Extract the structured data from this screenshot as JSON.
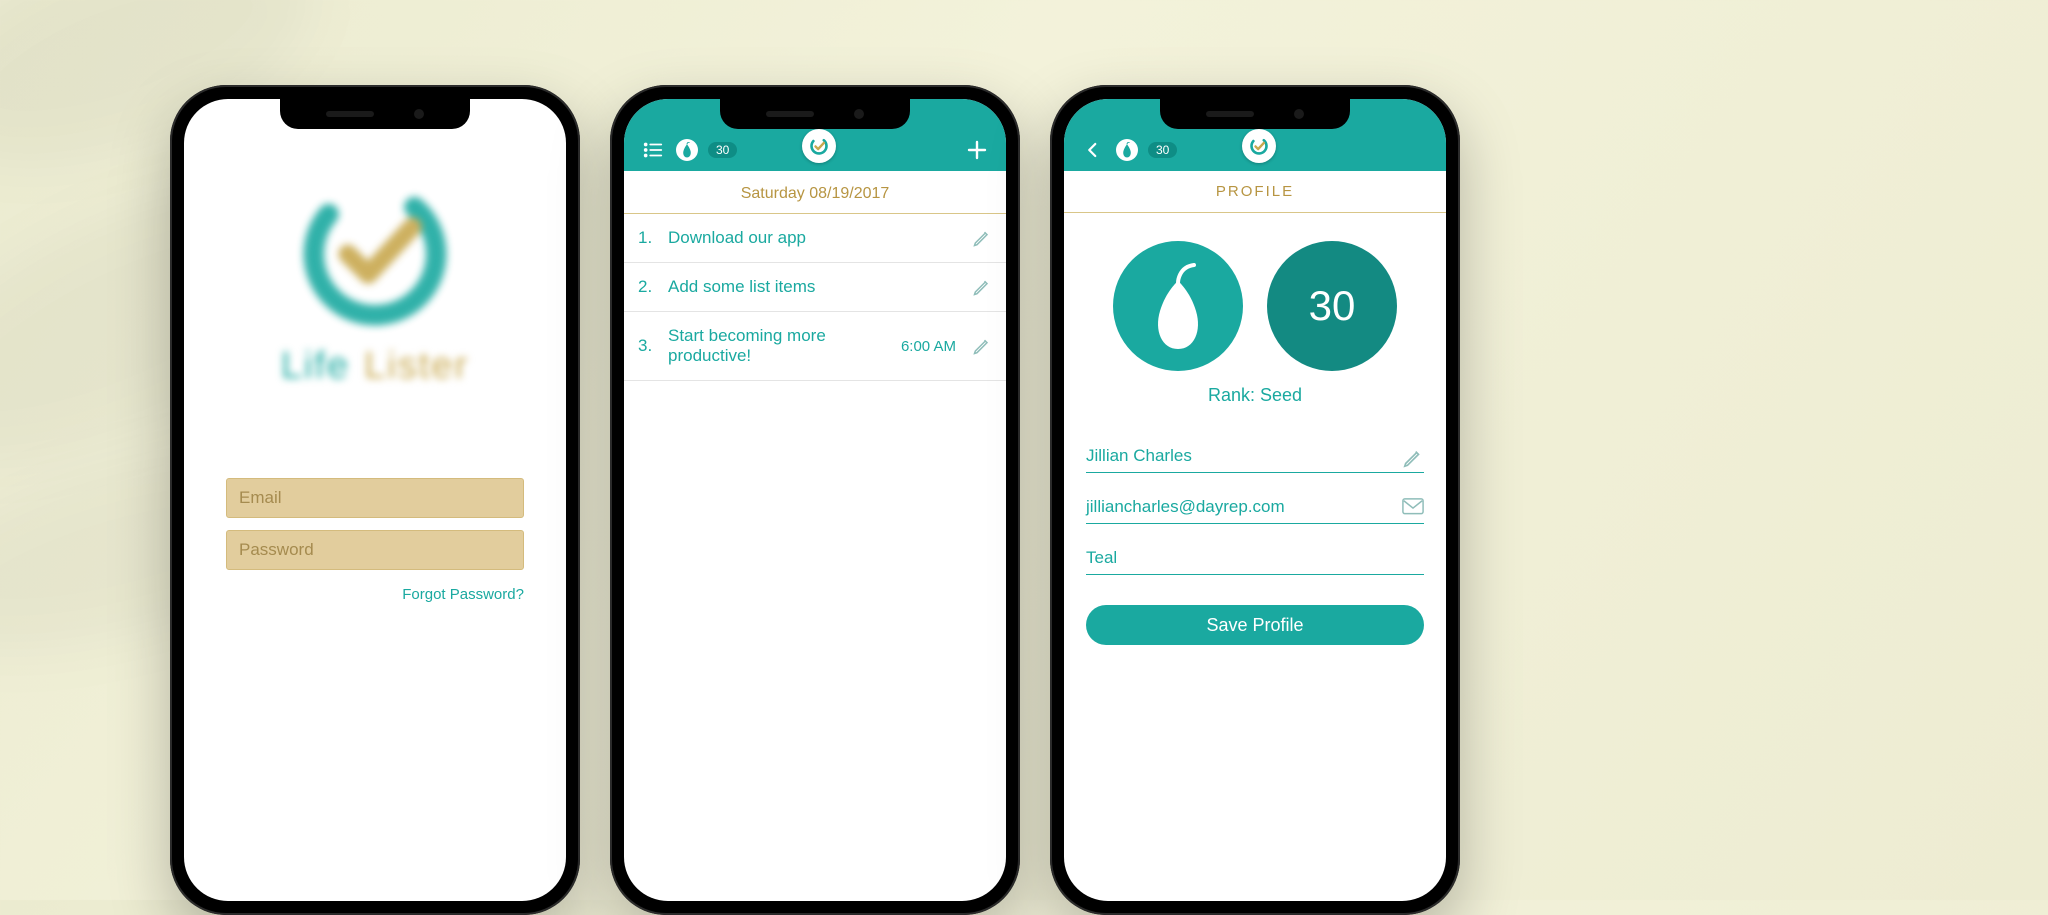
{
  "brand": {
    "word1": "Life",
    "word2": "Lister"
  },
  "colors": {
    "teal": "#1aa9a0",
    "tealDark": "#138a82",
    "gold": "#b79542",
    "fieldBg": "#e2cd9d"
  },
  "login": {
    "email_placeholder": "Email",
    "password_placeholder": "Password",
    "forgot": "Forgot Password?"
  },
  "listScreen": {
    "points": "30",
    "date": "Saturday 08/19/2017",
    "items": [
      {
        "n": "1.",
        "text": "Download our app",
        "time": ""
      },
      {
        "n": "2.",
        "text": "Add some list items",
        "time": ""
      },
      {
        "n": "3.",
        "text": "Start becoming more productive!",
        "time": "6:00 AM"
      }
    ]
  },
  "profile": {
    "title": "PROFILE",
    "points_badge": "30",
    "points_big": "30",
    "rank_prefix": "Rank: ",
    "rank_value": "Seed",
    "name": "Jillian Charles",
    "email": "jilliancharles@dayrep.com",
    "theme": "Teal",
    "save": "Save Profile"
  }
}
